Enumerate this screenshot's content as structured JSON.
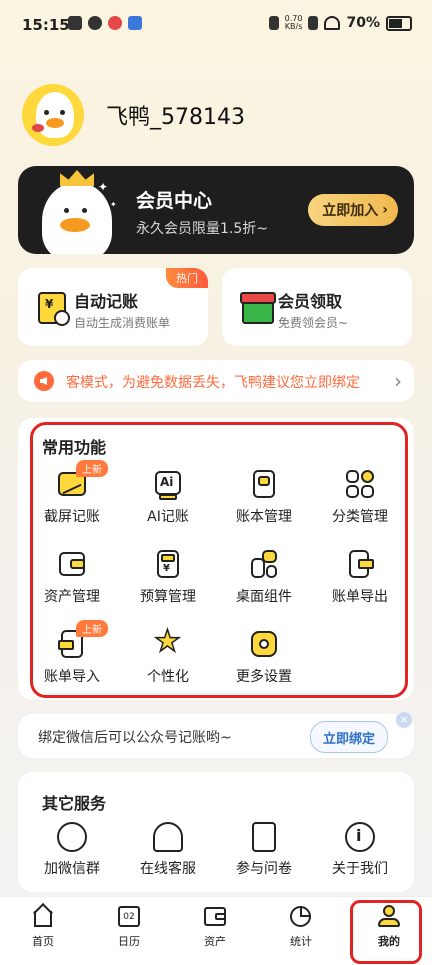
{
  "status_bar": {
    "time": "15:15",
    "speed": "0.70\nKB/s",
    "battery": "70%"
  },
  "profile": {
    "username": "飞鸭_578143"
  },
  "vip": {
    "title": "会员中心",
    "subtitle": "永久会员限量1.5折~",
    "button": "立即加入"
  },
  "feature_cards": {
    "auto": {
      "title": "自动记账",
      "subtitle": "自动生成消费账单",
      "badge": "热门"
    },
    "member": {
      "title": "会员领取",
      "subtitle": "免费领会员~"
    }
  },
  "notice": {
    "text": "客模式，为避免数据丢失，飞鸭建议您立即绑定"
  },
  "common": {
    "title": "常用功能",
    "items": [
      {
        "label": "截屏记账",
        "icon": "screenshot-bill-icon",
        "badge": "上新"
      },
      {
        "label": "AI记账",
        "icon": "ai-bill-icon"
      },
      {
        "label": "账本管理",
        "icon": "ledger-icon"
      },
      {
        "label": "分类管理",
        "icon": "category-icon"
      },
      {
        "label": "资产管理",
        "icon": "wallet-icon"
      },
      {
        "label": "预算管理",
        "icon": "budget-icon"
      },
      {
        "label": "桌面组件",
        "icon": "widget-icon"
      },
      {
        "label": "账单导出",
        "icon": "export-icon"
      },
      {
        "label": "账单导入",
        "icon": "import-icon",
        "badge": "上新"
      },
      {
        "label": "个性化",
        "icon": "star-icon"
      },
      {
        "label": "更多设置",
        "icon": "settings-icon"
      }
    ]
  },
  "bind_wechat": {
    "text": "绑定微信后可以公众号记账哟~",
    "button": "立即绑定",
    "close": "×"
  },
  "other": {
    "title": "其它服务",
    "items": [
      {
        "label": "加微信群",
        "icon": "wechat-group-icon"
      },
      {
        "label": "在线客服",
        "icon": "headset-icon"
      },
      {
        "label": "参与问卷",
        "icon": "survey-icon"
      },
      {
        "label": "关于我们",
        "icon": "info-icon"
      }
    ]
  },
  "bottom_nav": [
    {
      "label": "首页",
      "icon": "home-icon"
    },
    {
      "label": "日历",
      "icon": "calendar-icon",
      "day": "02"
    },
    {
      "label": "资产",
      "icon": "wallet-icon"
    },
    {
      "label": "统计",
      "icon": "pie-chart-icon"
    },
    {
      "label": "我的",
      "icon": "user-icon",
      "active": true
    }
  ],
  "colors": {
    "accent": "#ffd83b",
    "highlight": "#e32222",
    "notice": "#ff6a3c",
    "link": "#2d6fc9"
  }
}
